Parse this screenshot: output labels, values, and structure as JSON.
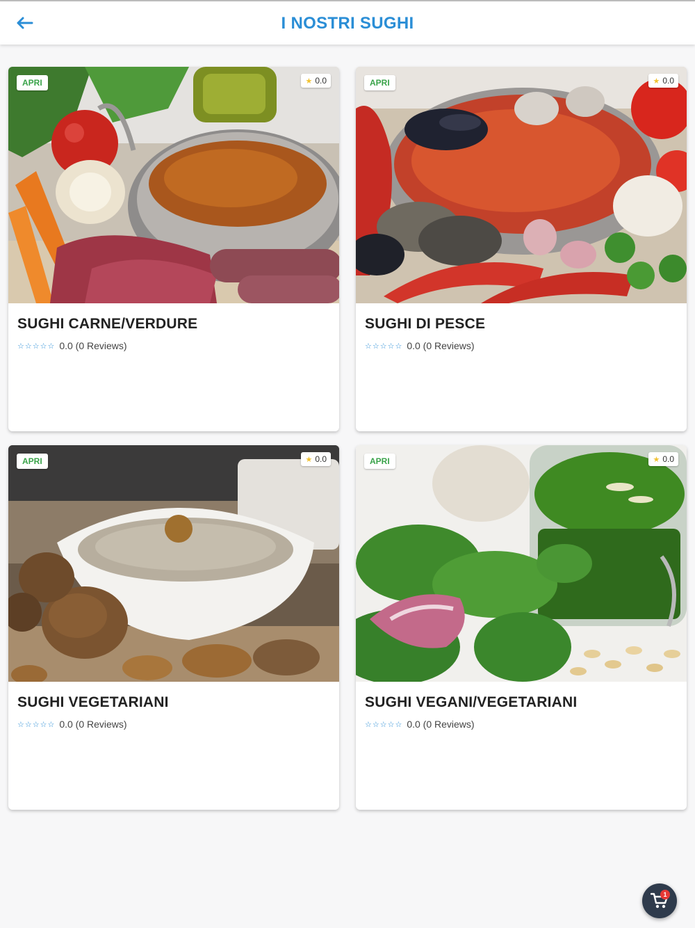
{
  "header": {
    "title": "I NOSTRI SUGHI",
    "back_icon": "arrow-left-icon"
  },
  "colors": {
    "accent": "#2b8ed6",
    "open_badge": "#3aa34a",
    "rating_star": "#f1c232",
    "fab": "#2f3b4c",
    "cart_badge": "#e53935"
  },
  "categories": [
    {
      "title": "SUGHI CARNE/VERDURE",
      "status": "APRI",
      "badge_rating": "0.0",
      "rating_text": "0.0 (0 Reviews)",
      "stars": "☆☆☆☆☆"
    },
    {
      "title": "SUGHI DI PESCE",
      "status": "APRI",
      "badge_rating": "0.0",
      "rating_text": "0.0 (0 Reviews)",
      "stars": "☆☆☆☆☆"
    },
    {
      "title": "SUGHI VEGETARIANI",
      "status": "APRI",
      "badge_rating": "0.0",
      "rating_text": "0.0 (0 Reviews)",
      "stars": "☆☆☆☆☆"
    },
    {
      "title": "SUGHI VEGANI/VEGETARIANI",
      "status": "APRI",
      "badge_rating": "0.0",
      "rating_text": "0.0 (0 Reviews)",
      "stars": "☆☆☆☆☆"
    }
  ],
  "cart": {
    "icon": "cart-icon",
    "count": "1"
  }
}
